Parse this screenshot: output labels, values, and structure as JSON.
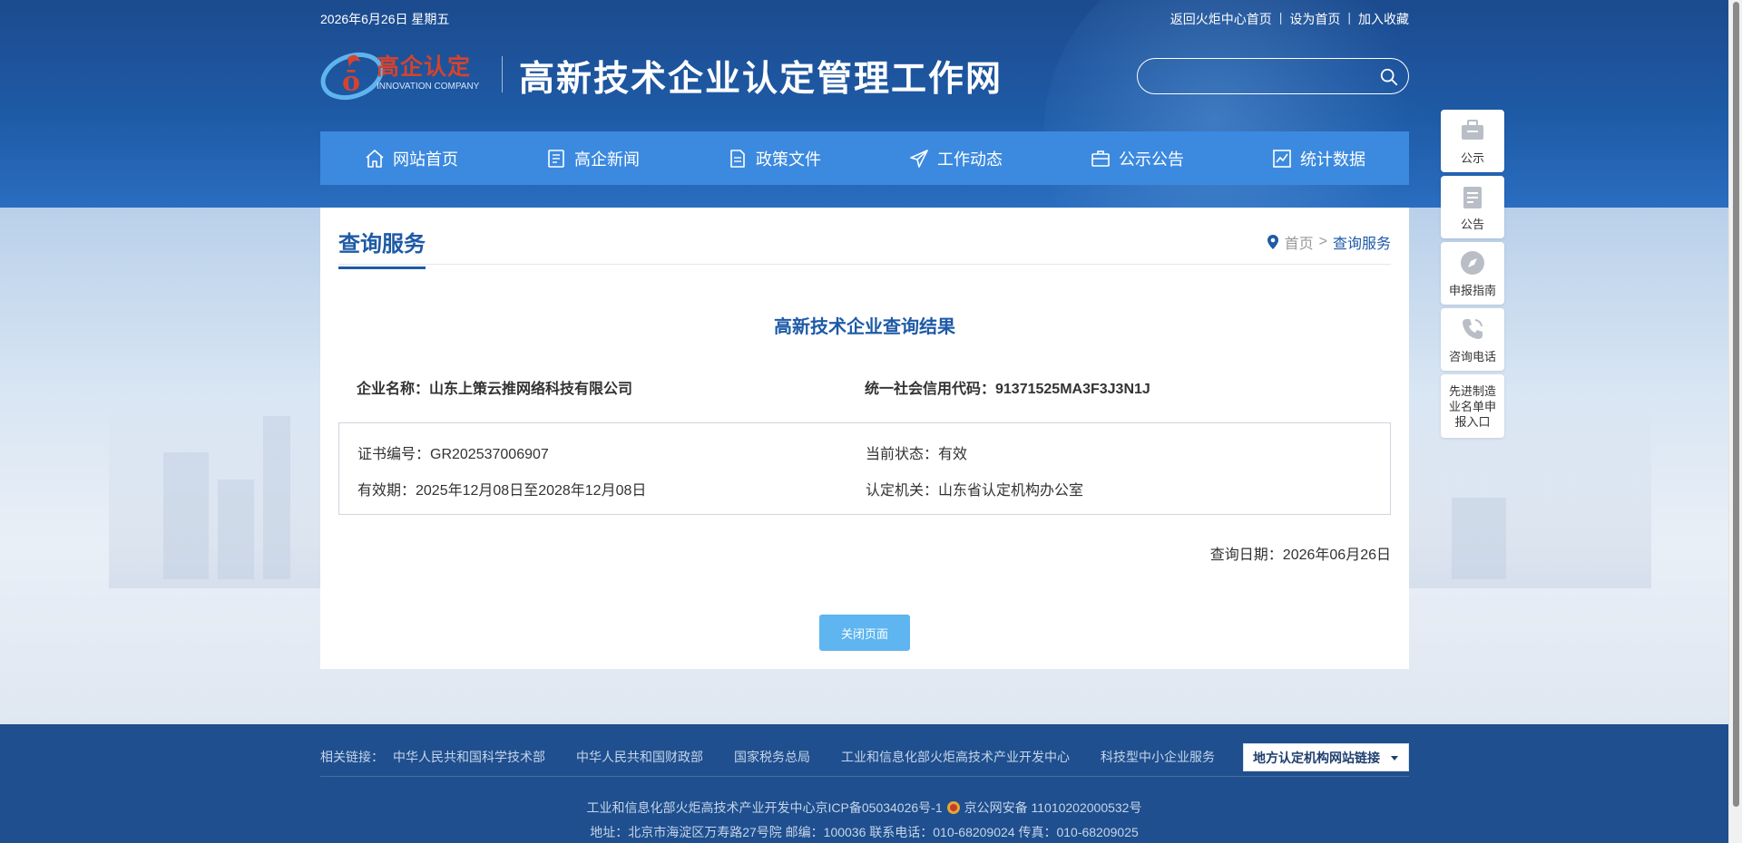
{
  "topbar": {
    "date": "2026年6月26日 星期五",
    "links": [
      "返回火炬中心首页",
      "设为首页",
      "加入收藏"
    ],
    "separator": "|"
  },
  "logo": {
    "brand_cn": "高企认定",
    "brand_en": "INNOVATION COMPANY",
    "site_title": "高新技术企业认定管理工作网"
  },
  "search": {
    "placeholder": "",
    "value": ""
  },
  "nav": [
    {
      "label": "网站首页",
      "icon": "home-icon"
    },
    {
      "label": "高企新闻",
      "icon": "news-icon"
    },
    {
      "label": "政策文件",
      "icon": "document-icon"
    },
    {
      "label": "工作动态",
      "icon": "paper-plane-icon"
    },
    {
      "label": "公示公告",
      "icon": "briefcase-icon"
    },
    {
      "label": "统计数据",
      "icon": "chart-icon"
    }
  ],
  "side": {
    "items": [
      {
        "label": "公示",
        "icon": "briefcase-icon"
      },
      {
        "label": "公告",
        "icon": "clipboard-icon"
      },
      {
        "label": "申报指南",
        "icon": "compass-icon"
      },
      {
        "label": "咨询电话",
        "icon": "phone-icon"
      }
    ],
    "special": "先进制造业名单申报入口"
  },
  "main": {
    "section_title": "查询服务",
    "breadcrumb": {
      "home": "首页",
      "sep": ">",
      "current": "查询服务"
    },
    "result_title": "高新技术企业查询结果",
    "company_label": "企业名称：山东上策云推网络科技有限公司",
    "credit_code": "统一社会信用代码：91371525MA3F3J3N1J",
    "cert_no": "证书编号：GR202537006907",
    "status": "当前状态：有效",
    "validity": "有效期：2025年12月08日至2028年12月08日",
    "authority": "认定机关：山东省认定机构办公室",
    "query_date": "查询日期：2026年06月26日",
    "close_button": "关闭页面"
  },
  "footer": {
    "links_label": "相关链接：",
    "links": [
      "中华人民共和国科学技术部",
      "中华人民共和国财政部",
      "国家税务总局",
      "工业和信息化部火炬高技术产业开发中心",
      "科技型中小企业服务"
    ],
    "select": "地方认定机构网站链接",
    "icp": "工业和信息化部火炬高技术产业开发中心京ICP备05034026号-1",
    "police": "京公网安备 11010202000532号",
    "address": "地址：北京市海淀区万寿路27号院 邮编：100036 联系电话：010-68209024 传真：010-68209025"
  },
  "colors": {
    "primary": "#1e5aa6",
    "nav_bg": "#3c8adf",
    "button": "#5eb5f0",
    "footer_bg": "#1f4f8e",
    "brand_red": "#d4432e"
  }
}
